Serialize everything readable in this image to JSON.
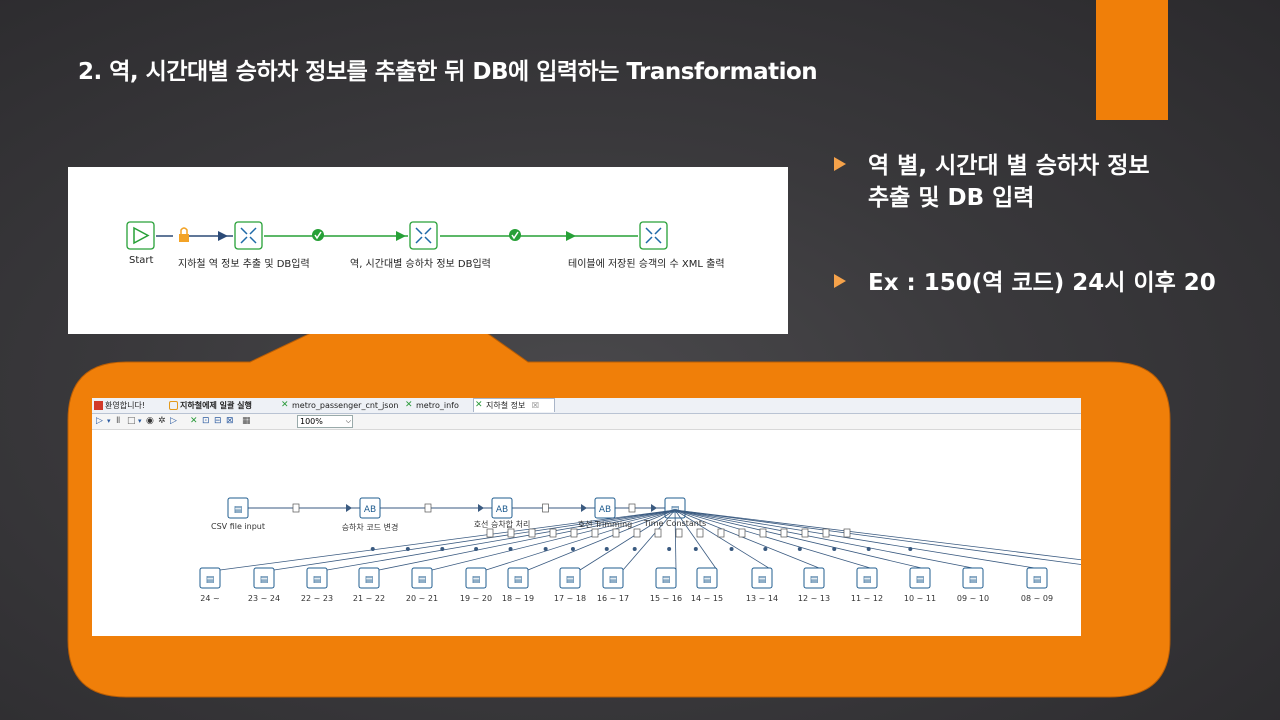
{
  "slide": {
    "title": "2. 역, 시간대별 승하차 정보를 추출한 뒤 DB에 입력하는 Transformation",
    "accent_color": "#f07f09",
    "bullets": [
      {
        "line1": "역 별, 시간대 별 승하차 정보",
        "line2": "추출 및 DB 입력"
      },
      {
        "line1": "Ex : 150(역 코드) 24시 이후 20"
      }
    ]
  },
  "job": {
    "steps": [
      {
        "label": "Start",
        "icon": "start-icon"
      },
      {
        "label": "지하철 역 정보 추출 및 DB입력",
        "icon": "transformation-icon"
      },
      {
        "label": "역, 시간대별 승하차 정보 DB입력",
        "icon": "transformation-icon"
      },
      {
        "label": "테이블에 저장된 승객의 수 XML 출력",
        "icon": "transformation-icon"
      }
    ]
  },
  "spoon": {
    "tabs": [
      {
        "label": "환영합니다!",
        "icon": "welcome-icon"
      },
      {
        "label": "지하철에제 일괄 실행",
        "icon": "job-icon"
      },
      {
        "label": "metro_passenger_cnt_json",
        "icon": "transformation-icon"
      },
      {
        "label": "metro_info",
        "icon": "transformation-icon"
      },
      {
        "label": "지하철 정보",
        "icon": "transformation-icon",
        "active": true,
        "close": "☒"
      }
    ],
    "zoom": "100%",
    "flow_steps": [
      {
        "label": "CSV file input"
      },
      {
        "label": "승하차 코드 변경"
      },
      {
        "label": "호선 승차합 처리"
      },
      {
        "label": "호선 Trimming"
      },
      {
        "label": "Time Constants"
      }
    ],
    "outputs": [
      "24 ~",
      "23 ~ 24",
      "22 ~ 23",
      "21 ~ 22",
      "20 ~ 21",
      "19 ~ 20",
      "18 ~ 19",
      "17 ~ 18",
      "16 ~ 17",
      "15 ~ 16",
      "14 ~ 15",
      "13 ~ 14",
      "12 ~ 13",
      "11 ~ 12",
      "10 ~ 11",
      "09 ~ 10",
      "08 ~ 09"
    ]
  }
}
